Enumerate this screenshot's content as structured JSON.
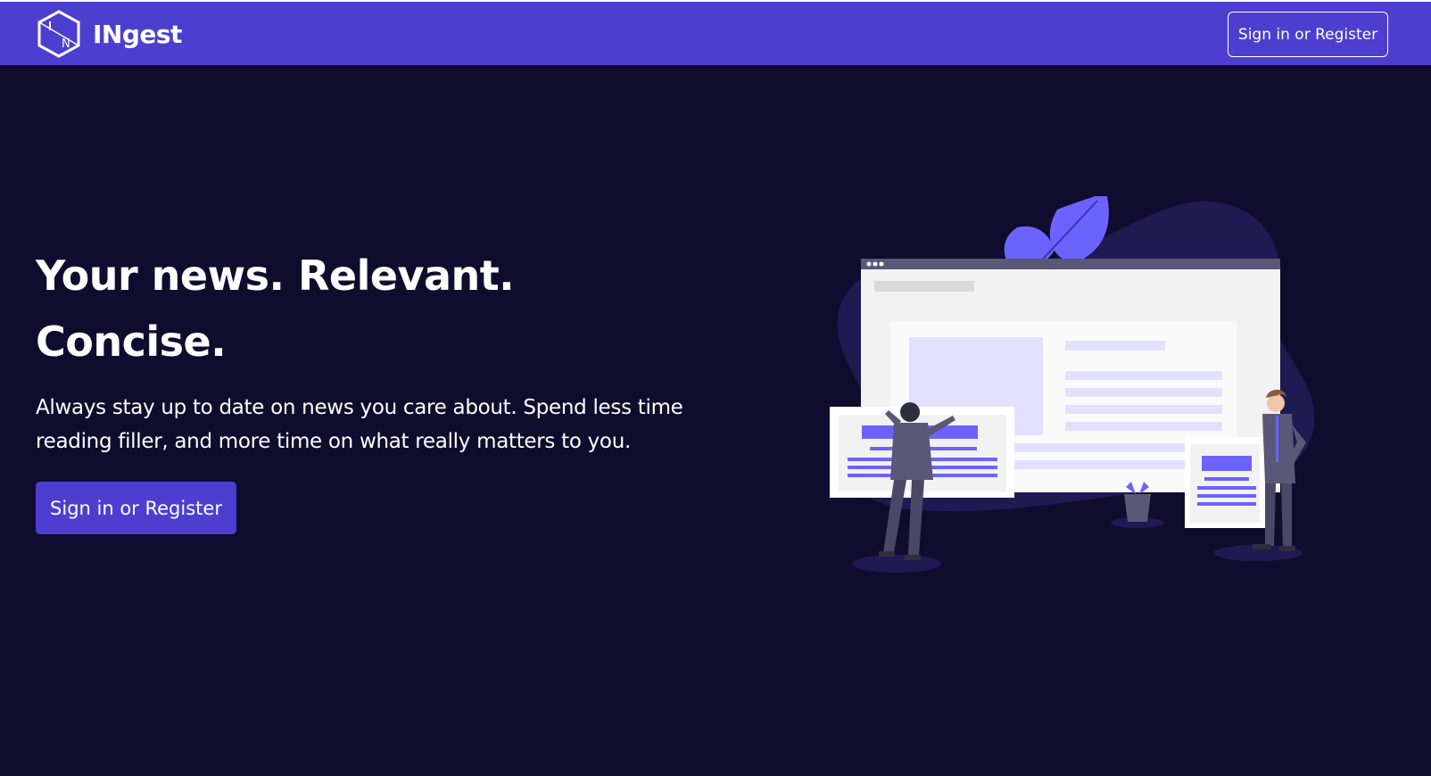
{
  "nav": {
    "brand": "INgest",
    "logo_letters": [
      "I",
      "N"
    ],
    "signin_label": "Sign in or Register"
  },
  "hero": {
    "title": "Your news. Relevant. Concise.",
    "description": "Always stay up to date on news you care about. Spend less time reading filler, and more time on what really matters to you.",
    "cta_label": "Sign in or Register"
  },
  "colors": {
    "background": "#0f0c2e",
    "navbar": "#4c3fcf",
    "accent": "#6c63ff",
    "text": "#ffffff"
  },
  "illustration": {
    "icon": "news-illustration-icon"
  }
}
